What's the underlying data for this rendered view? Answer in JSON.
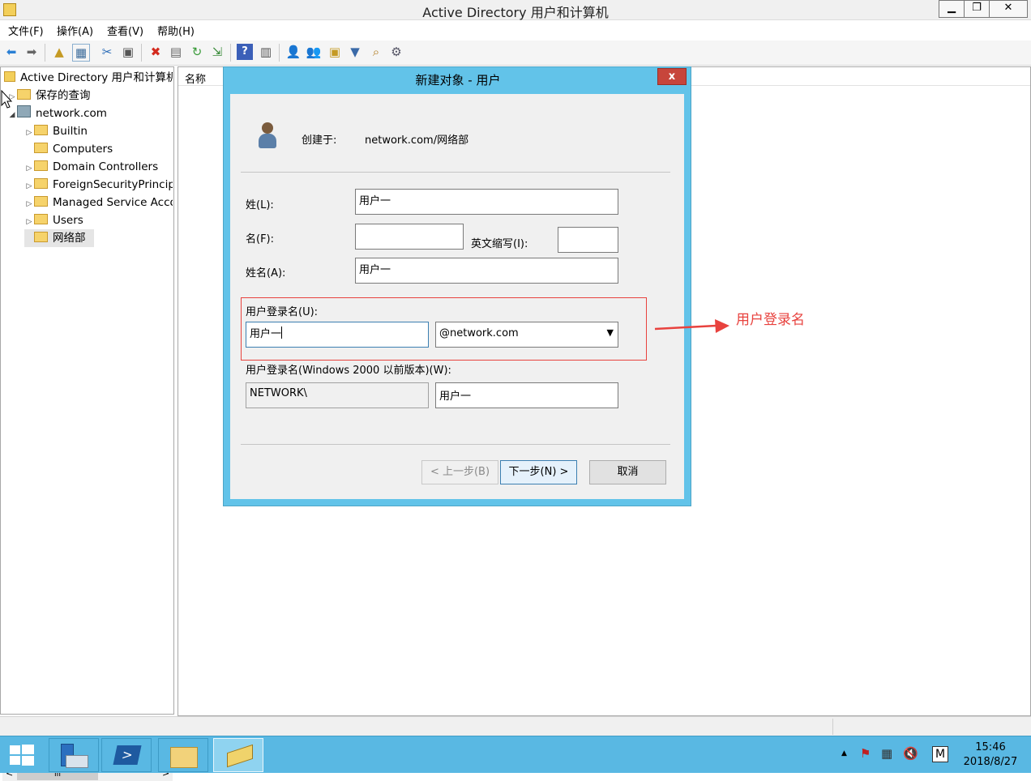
{
  "window": {
    "title": "Active Directory 用户和计算机",
    "controls": [
      "▁",
      "❐",
      "✕"
    ]
  },
  "menubar": [
    "文件(F)",
    "操作(A)",
    "查看(V)",
    "帮助(H)"
  ],
  "tree": {
    "root": "Active Directory 用户和计算机",
    "saved_queries": "保存的查询",
    "domain": "network.com",
    "children": [
      "Builtin",
      "Computers",
      "Domain Controllers",
      "ForeignSecurityPrincipals",
      "Managed Service Accounts",
      "Users",
      "网络部"
    ],
    "scroll_thumb": "III"
  },
  "list": {
    "column": "名称"
  },
  "dialog": {
    "title": "新建对象 - 用户",
    "close": "x",
    "created_in_label": "创建于:",
    "created_in_value": "network.com/网络部",
    "last_name_label": "姓(L):",
    "last_name_value": "用户一",
    "first_name_label": "名(F):",
    "first_name_value": "",
    "initials_label": "英文缩写(I):",
    "initials_value": "",
    "full_name_label": "姓名(A):",
    "full_name_value": "用户一",
    "logon_label": "用户登录名(U):",
    "logon_value": "用户一",
    "domain_select": "@network.com",
    "legacy_label": "用户登录名(Windows 2000 以前版本)(W):",
    "legacy_domain": "NETWORK\\",
    "legacy_user": "用户一",
    "back_btn": "< 上一步(B)",
    "next_btn": "下一步(N) >",
    "cancel_btn": "取消"
  },
  "annotation": {
    "text": "用户登录名",
    "color": "#e8423e"
  },
  "taskbar": {
    "time": "15:46",
    "date": "2018/8/27",
    "ime": "M"
  }
}
